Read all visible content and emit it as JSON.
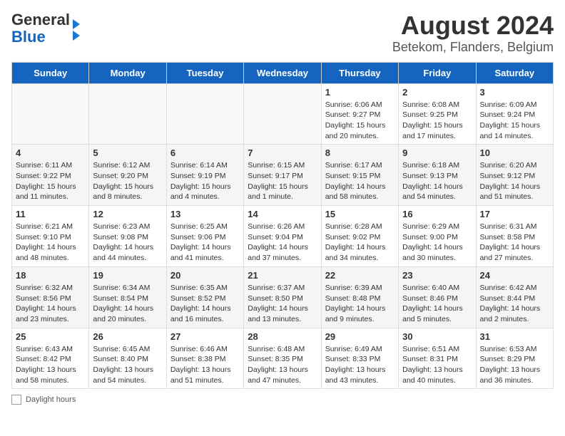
{
  "header": {
    "logo_general": "General",
    "logo_blue": "Blue",
    "title": "August 2024",
    "subtitle": "Betekom, Flanders, Belgium"
  },
  "days_of_week": [
    "Sunday",
    "Monday",
    "Tuesday",
    "Wednesday",
    "Thursday",
    "Friday",
    "Saturday"
  ],
  "weeks": [
    [
      {
        "day": "",
        "info": ""
      },
      {
        "day": "",
        "info": ""
      },
      {
        "day": "",
        "info": ""
      },
      {
        "day": "",
        "info": ""
      },
      {
        "day": "1",
        "info": "Sunrise: 6:06 AM\nSunset: 9:27 PM\nDaylight: 15 hours and 20 minutes."
      },
      {
        "day": "2",
        "info": "Sunrise: 6:08 AM\nSunset: 9:25 PM\nDaylight: 15 hours and 17 minutes."
      },
      {
        "day": "3",
        "info": "Sunrise: 6:09 AM\nSunset: 9:24 PM\nDaylight: 15 hours and 14 minutes."
      }
    ],
    [
      {
        "day": "4",
        "info": "Sunrise: 6:11 AM\nSunset: 9:22 PM\nDaylight: 15 hours and 11 minutes."
      },
      {
        "day": "5",
        "info": "Sunrise: 6:12 AM\nSunset: 9:20 PM\nDaylight: 15 hours and 8 minutes."
      },
      {
        "day": "6",
        "info": "Sunrise: 6:14 AM\nSunset: 9:19 PM\nDaylight: 15 hours and 4 minutes."
      },
      {
        "day": "7",
        "info": "Sunrise: 6:15 AM\nSunset: 9:17 PM\nDaylight: 15 hours and 1 minute."
      },
      {
        "day": "8",
        "info": "Sunrise: 6:17 AM\nSunset: 9:15 PM\nDaylight: 14 hours and 58 minutes."
      },
      {
        "day": "9",
        "info": "Sunrise: 6:18 AM\nSunset: 9:13 PM\nDaylight: 14 hours and 54 minutes."
      },
      {
        "day": "10",
        "info": "Sunrise: 6:20 AM\nSunset: 9:12 PM\nDaylight: 14 hours and 51 minutes."
      }
    ],
    [
      {
        "day": "11",
        "info": "Sunrise: 6:21 AM\nSunset: 9:10 PM\nDaylight: 14 hours and 48 minutes."
      },
      {
        "day": "12",
        "info": "Sunrise: 6:23 AM\nSunset: 9:08 PM\nDaylight: 14 hours and 44 minutes."
      },
      {
        "day": "13",
        "info": "Sunrise: 6:25 AM\nSunset: 9:06 PM\nDaylight: 14 hours and 41 minutes."
      },
      {
        "day": "14",
        "info": "Sunrise: 6:26 AM\nSunset: 9:04 PM\nDaylight: 14 hours and 37 minutes."
      },
      {
        "day": "15",
        "info": "Sunrise: 6:28 AM\nSunset: 9:02 PM\nDaylight: 14 hours and 34 minutes."
      },
      {
        "day": "16",
        "info": "Sunrise: 6:29 AM\nSunset: 9:00 PM\nDaylight: 14 hours and 30 minutes."
      },
      {
        "day": "17",
        "info": "Sunrise: 6:31 AM\nSunset: 8:58 PM\nDaylight: 14 hours and 27 minutes."
      }
    ],
    [
      {
        "day": "18",
        "info": "Sunrise: 6:32 AM\nSunset: 8:56 PM\nDaylight: 14 hours and 23 minutes."
      },
      {
        "day": "19",
        "info": "Sunrise: 6:34 AM\nSunset: 8:54 PM\nDaylight: 14 hours and 20 minutes."
      },
      {
        "day": "20",
        "info": "Sunrise: 6:35 AM\nSunset: 8:52 PM\nDaylight: 14 hours and 16 minutes."
      },
      {
        "day": "21",
        "info": "Sunrise: 6:37 AM\nSunset: 8:50 PM\nDaylight: 14 hours and 13 minutes."
      },
      {
        "day": "22",
        "info": "Sunrise: 6:39 AM\nSunset: 8:48 PM\nDaylight: 14 hours and 9 minutes."
      },
      {
        "day": "23",
        "info": "Sunrise: 6:40 AM\nSunset: 8:46 PM\nDaylight: 14 hours and 5 minutes."
      },
      {
        "day": "24",
        "info": "Sunrise: 6:42 AM\nSunset: 8:44 PM\nDaylight: 14 hours and 2 minutes."
      }
    ],
    [
      {
        "day": "25",
        "info": "Sunrise: 6:43 AM\nSunset: 8:42 PM\nDaylight: 13 hours and 58 minutes."
      },
      {
        "day": "26",
        "info": "Sunrise: 6:45 AM\nSunset: 8:40 PM\nDaylight: 13 hours and 54 minutes."
      },
      {
        "day": "27",
        "info": "Sunrise: 6:46 AM\nSunset: 8:38 PM\nDaylight: 13 hours and 51 minutes."
      },
      {
        "day": "28",
        "info": "Sunrise: 6:48 AM\nSunset: 8:35 PM\nDaylight: 13 hours and 47 minutes."
      },
      {
        "day": "29",
        "info": "Sunrise: 6:49 AM\nSunset: 8:33 PM\nDaylight: 13 hours and 43 minutes."
      },
      {
        "day": "30",
        "info": "Sunrise: 6:51 AM\nSunset: 8:31 PM\nDaylight: 13 hours and 40 minutes."
      },
      {
        "day": "31",
        "info": "Sunrise: 6:53 AM\nSunset: 8:29 PM\nDaylight: 13 hours and 36 minutes."
      }
    ]
  ],
  "footer": {
    "label": "Daylight hours"
  }
}
